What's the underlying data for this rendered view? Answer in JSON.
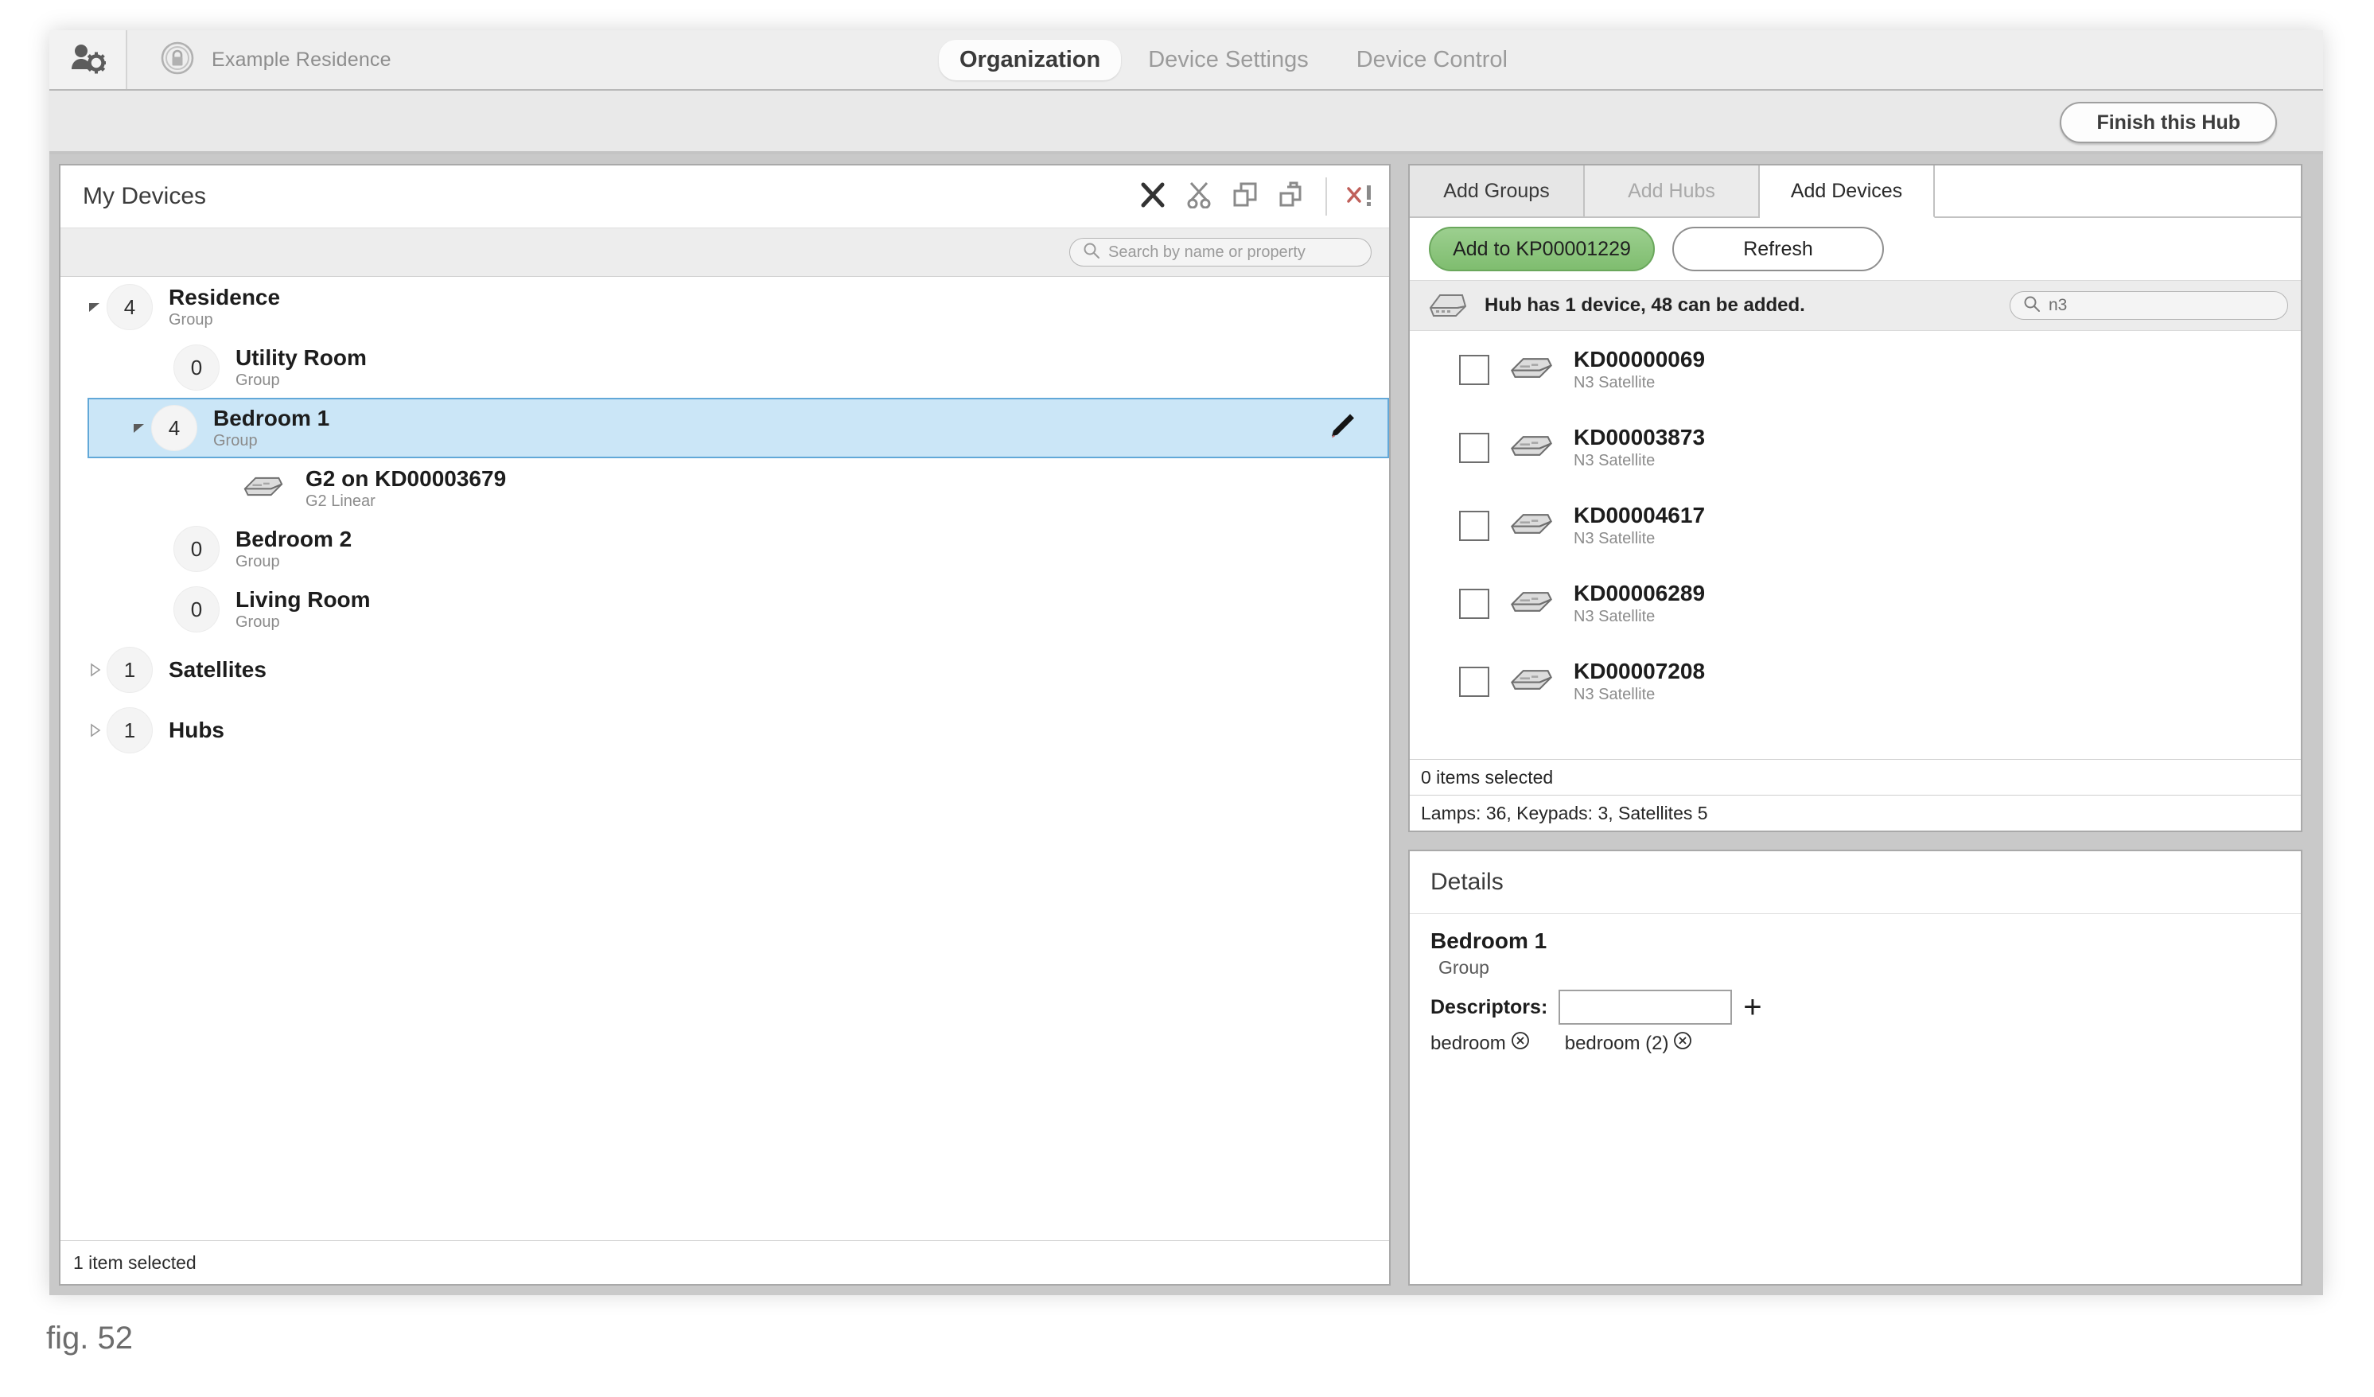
{
  "header": {
    "user_settings_icon": "user-gear-icon",
    "org_icon": "lock-badge-icon",
    "org_name": "Example Residence",
    "tabs": [
      {
        "label": "Organization",
        "active": true
      },
      {
        "label": "Device Settings",
        "active": false
      },
      {
        "label": "Device Control",
        "active": false
      }
    ]
  },
  "action_bar": {
    "finish_hub_label": "Finish this Hub"
  },
  "devices_panel": {
    "title": "My Devices",
    "toolbar": [
      {
        "name": "delete-icon",
        "glyph": "✕",
        "color": "#333333"
      },
      {
        "name": "cut-icon",
        "glyph": "✂",
        "color": "#8a8a8a"
      },
      {
        "name": "copy-icon",
        "glyph": "copy",
        "color": "#8a8a8a"
      },
      {
        "name": "paste-icon",
        "glyph": "paste",
        "color": "#8a8a8a"
      },
      {
        "name": "clear-errors-icon",
        "glyph": "x!",
        "color": "#c0605a"
      }
    ],
    "search": {
      "icon": "search-icon",
      "placeholder": "Search by name or property",
      "value": ""
    },
    "tree": [
      {
        "name": "Residence",
        "sub": "Group",
        "count": "4",
        "depth": 0,
        "twisty": "expanded",
        "selected": false,
        "kind": "group"
      },
      {
        "name": "Utility Room",
        "sub": "Group",
        "count": "0",
        "depth": 1,
        "twisty": "none",
        "selected": false,
        "kind": "group"
      },
      {
        "name": "Bedroom 1",
        "sub": "Group",
        "count": "4",
        "depth": 1,
        "twisty": "expanded",
        "selected": true,
        "kind": "group",
        "edit_icon": "pencil-icon"
      },
      {
        "name": "G2 on KD00003679",
        "sub": "G2 Linear",
        "count": "",
        "depth": 2,
        "twisty": "none",
        "selected": false,
        "kind": "device"
      },
      {
        "name": "Bedroom 2",
        "sub": "Group",
        "count": "0",
        "depth": 1,
        "twisty": "none",
        "selected": false,
        "kind": "group"
      },
      {
        "name": "Living Room",
        "sub": "Group",
        "count": "0",
        "depth": 1,
        "twisty": "none",
        "selected": false,
        "kind": "group"
      },
      {
        "name": "Satellites",
        "sub": "",
        "count": "1",
        "depth": 0,
        "twisty": "collapsed",
        "selected": false,
        "kind": "group"
      },
      {
        "name": "Hubs",
        "sub": "",
        "count": "1",
        "depth": 0,
        "twisty": "collapsed",
        "selected": false,
        "kind": "group"
      }
    ],
    "status": "1 item selected"
  },
  "add_panel": {
    "tabs": [
      {
        "label": "Add Groups",
        "state": "normal"
      },
      {
        "label": "Add Hubs",
        "state": "dim"
      },
      {
        "label": "Add Devices",
        "state": "active"
      }
    ],
    "add_to_hub_label": "Add to KP00001229",
    "refresh_label": "Refresh",
    "hub_icon": "hub-device-icon",
    "hub_info": "Hub has 1 device, 48 can be added.",
    "search": {
      "icon": "search-icon",
      "value": "n3",
      "placeholder": ""
    },
    "devices": [
      {
        "name": "KD00000069",
        "type": "N3 Satellite",
        "checked": false,
        "icon": "satellite-icon"
      },
      {
        "name": "KD00003873",
        "type": "N3 Satellite",
        "checked": false,
        "icon": "satellite-icon"
      },
      {
        "name": "KD00004617",
        "type": "N3 Satellite",
        "checked": false,
        "icon": "satellite-icon"
      },
      {
        "name": "KD00006289",
        "type": "N3 Satellite",
        "checked": false,
        "icon": "satellite-icon"
      },
      {
        "name": "KD00007208",
        "type": "N3 Satellite",
        "checked": false,
        "icon": "satellite-icon"
      }
    ],
    "selection_status": "0 items selected",
    "inventory_status": "Lamps: 36, Keypads: 3, Satellites 5"
  },
  "details_panel": {
    "title": "Details",
    "name": "Bedroom 1",
    "type": "Group",
    "descriptors_label": "Descriptors:",
    "descriptor_input_value": "",
    "add_button_glyph": "+",
    "chips": [
      {
        "label": "bedroom"
      },
      {
        "label": "bedroom (2)"
      }
    ]
  },
  "figure": {
    "caption": "fig. 52"
  },
  "colors": {
    "accent_green": "#7fbd6f",
    "selection_blue": "#cbe6f7",
    "selection_border": "#62a8d8",
    "error_red": "#c0605a"
  }
}
